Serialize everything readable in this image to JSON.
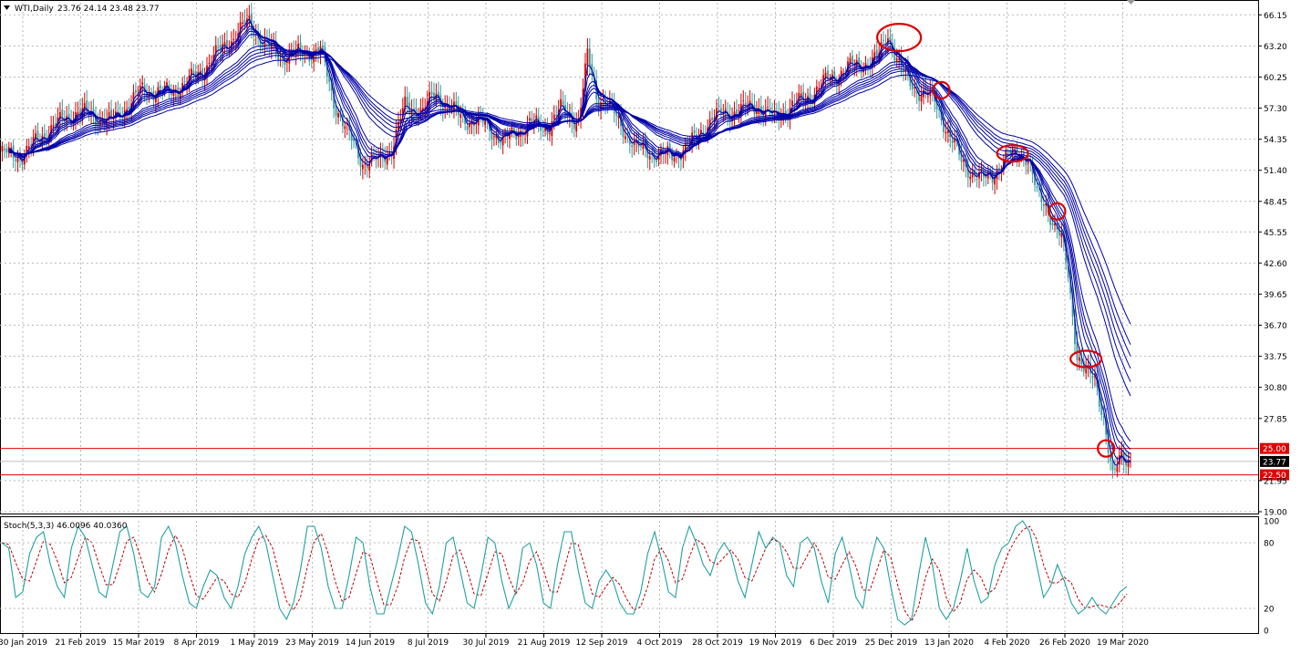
{
  "header": {
    "symbol": "WTI,Daily",
    "ohlc": "23.76 24.14 23.48 23.77"
  },
  "stoch_header": "Stoch(5,3,3) 46.0096 40.0360",
  "colors": {
    "bull": "#d40000",
    "bear": "#3a9a9a",
    "ma": "#0000aa",
    "level": "#e00000",
    "circle": "#dd0000",
    "stoch_main": "#20a0a0",
    "stoch_signal": "#c00000"
  },
  "chart_data": [
    {
      "type": "candlestick",
      "title": "WTI,Daily",
      "y_ticks": [
        "66.15",
        "63.20",
        "60.25",
        "57.30",
        "54.35",
        "51.40",
        "48.45",
        "45.55",
        "42.60",
        "39.65",
        "36.70",
        "33.75",
        "30.80",
        "27.85",
        "21.95",
        "19.00"
      ],
      "ylim": [
        19.0,
        67.3
      ],
      "x_ticks": [
        "30 Jan 2019",
        "21 Feb 2019",
        "15 Mar 2019",
        "8 Apr 2019",
        "1 May 2019",
        "23 May 2019",
        "14 Jun 2019",
        "8 Jul 2019",
        "30 Jul 2019",
        "21 Aug 2019",
        "12 Sep 2019",
        "4 Oct 2019",
        "28 Oct 2019",
        "19 Nov 2019",
        "6 Dec 2019",
        "25 Dec 2019",
        "13 Jan 2020",
        "4 Feb 2020",
        "26 Feb 2020",
        "19 Mar 2020"
      ],
      "price_path": [
        [
          0,
          53.0
        ],
        [
          10,
          52.8
        ],
        [
          22,
          55.3
        ],
        [
          35,
          57.0
        ],
        [
          50,
          56.0
        ],
        [
          64,
          59.0
        ],
        [
          76,
          58.8
        ],
        [
          88,
          60.3
        ],
        [
          100,
          63.0
        ],
        [
          112,
          65.5
        ],
        [
          118,
          63.5
        ],
        [
          126,
          62.2
        ],
        [
          136,
          62.5
        ],
        [
          144,
          62.8
        ],
        [
          150,
          58.0
        ],
        [
          156,
          55.0
        ],
        [
          163,
          52.2
        ],
        [
          170,
          52.3
        ],
        [
          176,
          53.5
        ],
        [
          182,
          57.5
        ],
        [
          190,
          57.0
        ],
        [
          196,
          58.7
        ],
        [
          202,
          57.2
        ],
        [
          210,
          56.2
        ],
        [
          218,
          55.8
        ],
        [
          226,
          54.2
        ],
        [
          232,
          55.0
        ],
        [
          238,
          55.8
        ],
        [
          246,
          55.5
        ],
        [
          252,
          57.2
        ],
        [
          260,
          56.0
        ],
        [
          264,
          62.2
        ],
        [
          268,
          58.5
        ],
        [
          272,
          58.0
        ],
        [
          278,
          56.0
        ],
        [
          286,
          53.5
        ],
        [
          294,
          53.0
        ],
        [
          302,
          52.7
        ],
        [
          312,
          54.2
        ],
        [
          320,
          56.4
        ],
        [
          330,
          57.0
        ],
        [
          340,
          57.5
        ],
        [
          348,
          56.3
        ],
        [
          356,
          57.5
        ],
        [
          364,
          58.5
        ],
        [
          372,
          60.0
        ],
        [
          380,
          61.0
        ],
        [
          388,
          61.6
        ],
        [
          394,
          61.8
        ],
        [
          399,
          64.5
        ],
        [
          404,
          61.3
        ],
        [
          408,
          60.0
        ],
        [
          414,
          58.7
        ],
        [
          420,
          58.0
        ],
        [
          426,
          55.0
        ],
        [
          432,
          52.3
        ],
        [
          438,
          51.0
        ],
        [
          442,
          50.5
        ],
        [
          446,
          51.0
        ],
        [
          452,
          52.5
        ],
        [
          458,
          53.2
        ],
        [
          462,
          52.5
        ],
        [
          466,
          49.0
        ],
        [
          470,
          48.3
        ],
        [
          474,
          46.0
        ],
        [
          477,
          44.8
        ],
        [
          480,
          41.5
        ],
        [
          484,
          34.0
        ],
        [
          488,
          32.0
        ],
        [
          492,
          31.7
        ],
        [
          496,
          28.0
        ],
        [
          500,
          22.0
        ],
        [
          504,
          24.5
        ],
        [
          508,
          23.77
        ]
      ],
      "ma_periods": [
        3,
        5,
        8,
        10,
        12,
        15,
        30,
        35,
        40,
        45,
        50,
        60
      ],
      "horizontal_levels": [
        {
          "value": 25.0,
          "label": "25.00"
        },
        {
          "value": 22.5,
          "label": "22.50"
        }
      ],
      "current_price": {
        "value": 23.77,
        "label": "23.77"
      },
      "circled_points": [
        {
          "date_index": 404,
          "price": 64.0
        },
        {
          "date_index": 423,
          "price": 59.0
        },
        {
          "date_index": 455,
          "price": 53.0
        },
        {
          "date_index": 475,
          "price": 47.5
        },
        {
          "date_index": 488,
          "price": 33.5
        },
        {
          "date_index": 497,
          "price": 25.0
        }
      ]
    },
    {
      "type": "line",
      "title": "Stoch(5,3,3) 46.0096 40.0360",
      "y_ticks": [
        "100",
        "80",
        "20",
        "0"
      ],
      "ylim": [
        0,
        100
      ],
      "series": [
        {
          "name": "",
          "values": [
            80,
            75,
            30,
            35,
            70,
            85,
            90,
            60,
            40,
            30,
            75,
            95,
            85,
            60,
            35,
            30,
            60,
            90,
            95,
            70,
            35,
            30,
            40,
            85,
            95,
            80,
            50,
            25,
            20,
            40,
            55,
            50,
            30,
            20,
            40,
            70,
            85,
            95,
            80,
            50,
            20,
            10,
            25,
            55,
            95,
            95,
            75,
            40,
            20,
            20,
            50,
            85,
            80,
            40,
            15,
            15,
            40,
            65,
            95,
            90,
            60,
            25,
            15,
            40,
            80,
            85,
            55,
            25,
            20,
            50,
            85,
            80,
            45,
            20,
            35,
            75,
            80,
            60,
            25,
            20,
            60,
            90,
            90,
            55,
            25,
            20,
            45,
            55,
            45,
            25,
            15,
            15,
            35,
            70,
            90,
            65,
            35,
            30,
            75,
            95,
            80,
            60,
            50,
            70,
            80,
            70,
            45,
            30,
            60,
            90,
            75,
            85,
            80,
            50,
            40,
            80,
            85,
            75,
            45,
            25,
            70,
            85,
            60,
            30,
            20,
            60,
            85,
            75,
            40,
            10,
            5,
            10,
            50,
            85,
            60,
            20,
            10,
            20,
            45,
            75,
            45,
            25,
            30,
            60,
            75,
            80,
            95,
            100,
            90,
            60,
            30,
            40,
            60,
            45,
            25,
            15,
            20,
            30,
            20,
            15,
            25,
            35,
            40
          ]
        }
      ]
    }
  ]
}
